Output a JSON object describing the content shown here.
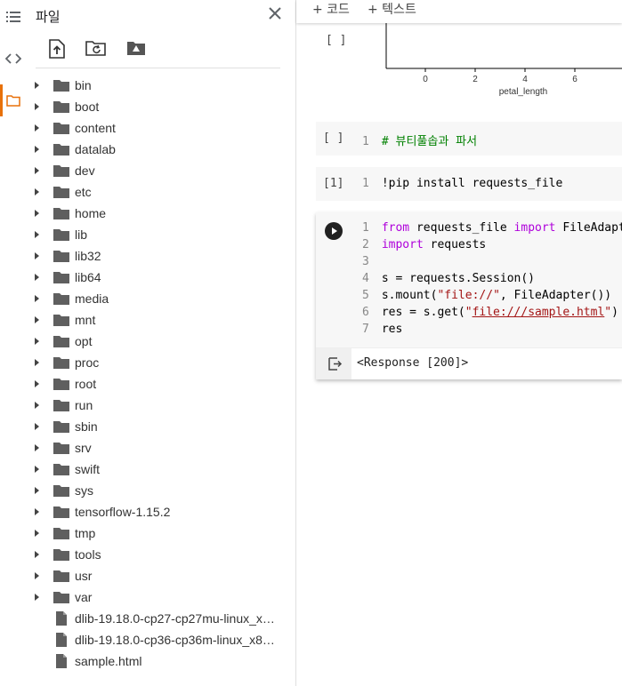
{
  "rail": {
    "icons": [
      "list-icon",
      "code-icon",
      "folder-icon"
    ]
  },
  "panel": {
    "title": "파일",
    "toolbar": [
      "upload-file-icon",
      "refresh-folder-icon",
      "drive-icon"
    ],
    "folders": [
      "bin",
      "boot",
      "content",
      "datalab",
      "dev",
      "etc",
      "home",
      "lib",
      "lib32",
      "lib64",
      "media",
      "mnt",
      "opt",
      "proc",
      "root",
      "run",
      "sbin",
      "srv",
      "swift",
      "sys",
      "tensorflow-1.15.2",
      "tmp",
      "tools",
      "usr",
      "var"
    ],
    "files": [
      "dlib-19.18.0-cp27-cp27mu-linux_x8...",
      "dlib-19.18.0-cp36-cp36m-linux_x86...",
      "sample.html"
    ]
  },
  "topbar": {
    "code_label": "+ 코드",
    "text_label": "+ 텍스트"
  },
  "chart_data": {
    "type": "scatter",
    "xlabel": "petal_length",
    "tick_labels": [
      "0",
      "2",
      "4",
      "6"
    ],
    "series": []
  },
  "cells": {
    "chart_cell_exec": "[ ]",
    "comment_cell": {
      "exec": "[ ]",
      "line_no": "1",
      "code": "# 뷰티풀솝과 파서"
    },
    "pip_cell": {
      "exec": "[1]",
      "line_no": "1",
      "code": "!pip install requests_file"
    },
    "active_cell": {
      "lines": [
        {
          "n": "1",
          "code": "from requests_file import FileAdapter"
        },
        {
          "n": "2",
          "code": "import requests"
        },
        {
          "n": "3",
          "code": ""
        },
        {
          "n": "4",
          "code": "s = requests.Session()"
        },
        {
          "n": "5",
          "code": "s.mount(\"file://\", FileAdapter())"
        },
        {
          "n": "6",
          "code": "res = s.get(\"file:///sample.html\")"
        },
        {
          "n": "7",
          "code": "res"
        }
      ],
      "output": "<Response [200]>"
    }
  }
}
